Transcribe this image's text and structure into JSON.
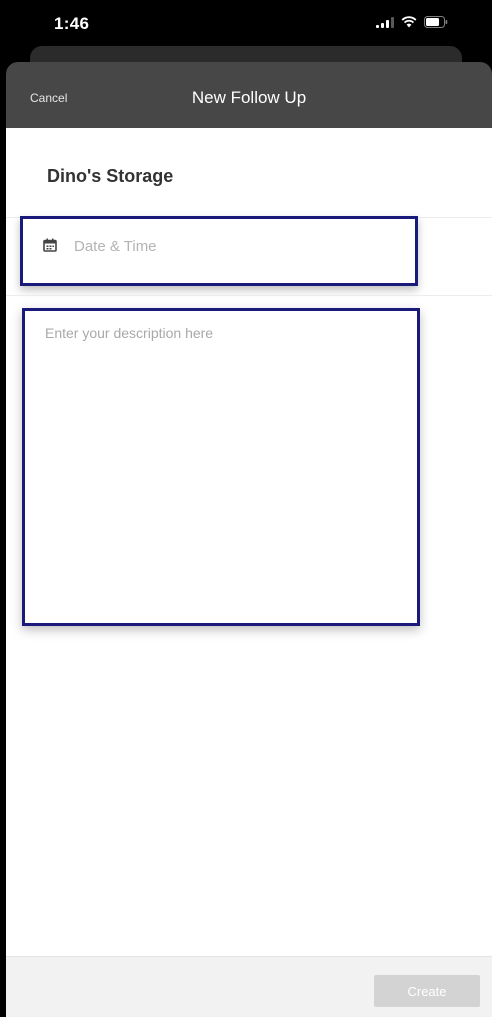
{
  "status_bar": {
    "time": "1:46",
    "icons": [
      "signal-icon",
      "wifi-icon",
      "battery-icon"
    ]
  },
  "header": {
    "cancel_label": "Cancel",
    "title": "New Follow Up"
  },
  "form": {
    "account_name": "Dino's Storage",
    "date_time_placeholder": "Date & Time",
    "date_icon": "calendar-icon",
    "description_placeholder": "Enter your description here"
  },
  "footer": {
    "create_label": "Create"
  },
  "colors": {
    "header_background": "#474747",
    "highlight_border": "#1a1a7a",
    "create_disabled": "#d3d3d3"
  }
}
